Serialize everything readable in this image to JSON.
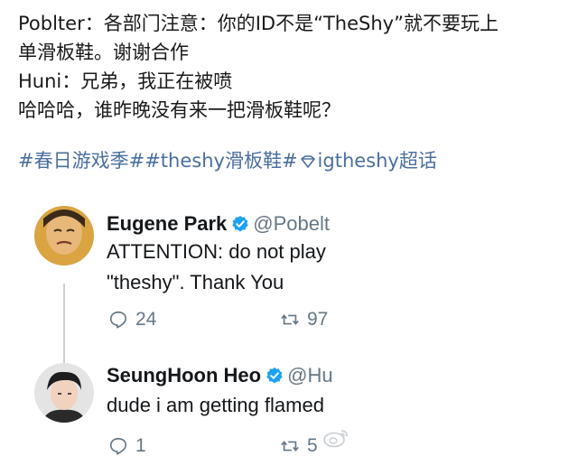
{
  "post": {
    "line1": "Poblter：各部门注意：你的ID不是“TheShy”就不要玩上",
    "line2": "单滑板鞋。谢谢合作",
    "line3": "Huni：兄弟，我正在被喷",
    "line4": "哈哈哈，谁昨晚没有来一把滑板鞋呢？",
    "hashtags": {
      "tag1": "#春日游戏季#",
      "tag2": "#theshy滑板鞋#",
      "tag3": "igtheshy超话"
    }
  },
  "tweets": [
    {
      "name": "Eugene Park",
      "handle": "@Pobelt",
      "text_line1": "ATTENTION: do not play",
      "text_line2": "\"theshy\". Thank You",
      "replies": "24",
      "retweets": "97"
    },
    {
      "name": "SeungHoon Heo",
      "handle": "@Hu",
      "text_line1": "dude i am getting flamed",
      "replies": "1",
      "retweets": "5"
    }
  ],
  "colors": {
    "hashtag": "#4a6f9e",
    "verified": "#1da1f2",
    "muted": "#657786"
  }
}
